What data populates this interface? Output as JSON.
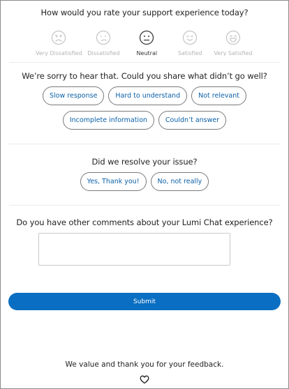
{
  "rating_question": "How would you rate your support experience today?",
  "ratings": [
    {
      "label": "Very Dissatisfied",
      "icon": "very-dissatisfied-face-icon",
      "selected": false
    },
    {
      "label": "Dissatisfied",
      "icon": "dissatisfied-face-icon",
      "selected": false
    },
    {
      "label": "Neutral",
      "icon": "neutral-face-icon",
      "selected": true
    },
    {
      "label": "Satisfied",
      "icon": "satisfied-face-icon",
      "selected": false
    },
    {
      "label": "Very Satisfied",
      "icon": "very-satisfied-face-icon",
      "selected": false
    }
  ],
  "issue_question": "We’re sorry to hear that. Could you share what didn’t go well?",
  "issue_options": [
    "Slow response",
    "Hard to understand",
    "Not relevant",
    "Incomplete information",
    "Couldn’t answer"
  ],
  "resolve_question": "Did we resolve your issue?",
  "resolve_options": [
    "Yes, Thank you!",
    "No, not really"
  ],
  "comments_question": "Do you have other comments about your Lumi Chat experience?",
  "comments_value": "",
  "submit_label": "Submit",
  "thanks_text": "We value and thank you for your feedback.",
  "colors": {
    "accent": "#0a6fc2",
    "chip_text": "#0a5fa8",
    "muted": "#b3b3b3"
  }
}
